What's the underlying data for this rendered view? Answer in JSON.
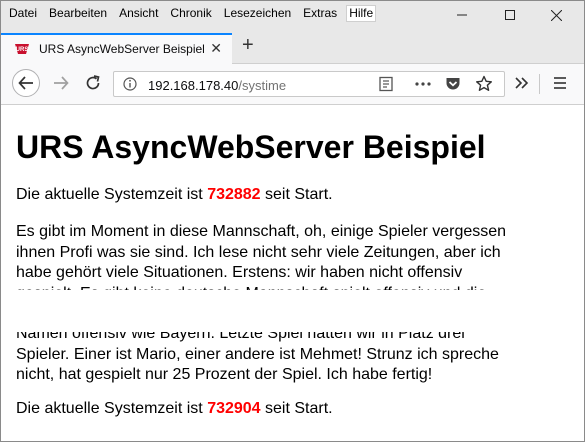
{
  "menu": {
    "items": [
      "Datei",
      "Bearbeiten",
      "Ansicht",
      "Chronik",
      "Lesezeichen",
      "Extras",
      "Hilfe"
    ]
  },
  "tab": {
    "title": "URS AsyncWebServer Beispiel"
  },
  "nav": {
    "url_host": "192.168.178.40",
    "url_path": "/systime"
  },
  "page": {
    "heading": "URS AsyncWebServer Beispiel",
    "time_line_1": {
      "prefix": "Die aktuelle Systemzeit ist ",
      "value": "732882",
      "suffix": " seit Start."
    },
    "paragraph_lines": [
      "Es gibt im Moment in diese Mannschaft, oh, einige Spieler vergessen",
      "ihnen Profi was sie sind. Ich lese nicht sehr viele Zeitungen, aber ich",
      "habe gehört viele Situationen. Erstens: wir haben nicht offensiv",
      "gespielt. Es gibt keine deutsche Mannschaft spielt offensiv und die"
    ],
    "paragraph_lines_bottom": [
      "Namen offensiv wie Bayern. Letzte Spiel hatten wir in Platz drei",
      "Spieler. Einer ist Mario, einer andere ist Mehmet! Strunz ich spreche",
      "nicht, hat gespielt nur 25 Prozent der Spiel. Ich habe fertig!"
    ],
    "time_line_2": {
      "prefix": "Die aktuelle Systemzeit ist ",
      "value": "732904",
      "suffix": " seit Start."
    }
  }
}
